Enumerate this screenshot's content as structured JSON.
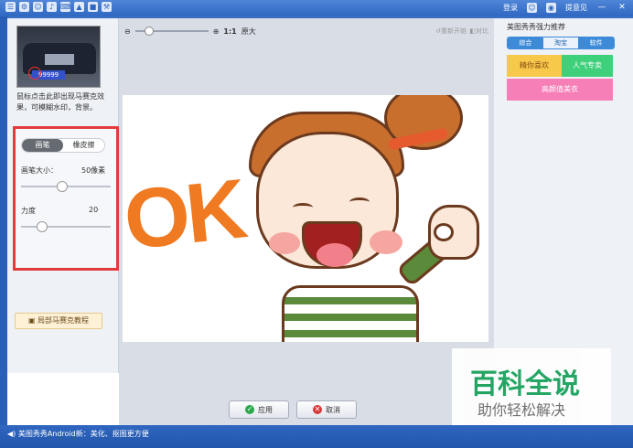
{
  "titlebar": {
    "icons": [
      "☰",
      "⚙",
      "☺",
      "♪",
      "⌨",
      "▲",
      "■",
      "⚒"
    ],
    "login": "登录",
    "feedback": "提意见",
    "min": "—",
    "close": "✕"
  },
  "left": {
    "plate_text": "99999",
    "hint": "鼠标点击此即出现马赛克效果，可模糊水印，背景。",
    "tabs": [
      "画笔",
      "橡皮擦"
    ],
    "brush_size_label": "画笔大小：",
    "brush_size_value": "50像素",
    "brush_size_level": 0.45,
    "strength_label": "力度",
    "strength_value": "20",
    "strength_level": 0.2,
    "tutorial": "局部马赛克教程"
  },
  "toolbar": {
    "zoom_ratio": "1:1",
    "original": "原大",
    "reset": "重新开始",
    "compare": "对比"
  },
  "image": {
    "ok_text": "OK"
  },
  "buttons": {
    "apply": "应用",
    "cancel": "取消"
  },
  "right": {
    "title": "美图秀秀强力推荐",
    "tabs": [
      "综合",
      "淘宝",
      "软件"
    ],
    "tiles": [
      "精你喜欢",
      "人气专卖",
      "高颜值美衣"
    ]
  },
  "watermark": {
    "title": "百科全说",
    "subtitle": "助你轻松解决"
  },
  "status": {
    "text": "美图秀秀Android新：美化、抠图更方便"
  }
}
